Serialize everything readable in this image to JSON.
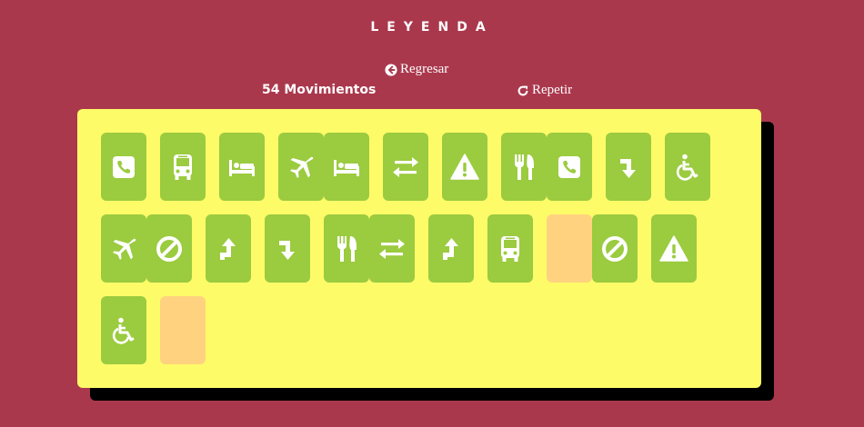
{
  "header": {
    "title": "LEYENDA"
  },
  "controls": {
    "back_label": "Regresar",
    "moves_label": "54 Movimientos",
    "repeat_label": "Repetir"
  },
  "colors": {
    "background": "#aa384d",
    "board": "#fefb68",
    "card_revealed": "#9bcb3f",
    "card_hidden": "#ffd27f"
  },
  "cards": [
    {
      "icon": "phone",
      "state": "revealed"
    },
    {
      "icon": "bus",
      "state": "revealed"
    },
    {
      "icon": "bed",
      "state": "revealed"
    },
    {
      "icon": "plane",
      "state": "revealed"
    },
    {
      "icon": "bed",
      "state": "revealed"
    },
    {
      "icon": "exchange",
      "state": "revealed"
    },
    {
      "icon": "warning",
      "state": "revealed"
    },
    {
      "icon": "cutlery",
      "state": "revealed"
    },
    {
      "icon": "phone",
      "state": "revealed"
    },
    {
      "icon": "turn-down",
      "state": "revealed"
    },
    {
      "icon": "wheelchair",
      "state": "revealed"
    },
    {
      "icon": "plane",
      "state": "revealed"
    },
    {
      "icon": "ban",
      "state": "revealed"
    },
    {
      "icon": "turn-up",
      "state": "revealed"
    },
    {
      "icon": "turn-down",
      "state": "revealed"
    },
    {
      "icon": "cutlery",
      "state": "revealed"
    },
    {
      "icon": "exchange",
      "state": "revealed"
    },
    {
      "icon": "turn-up",
      "state": "revealed"
    },
    {
      "icon": "bus",
      "state": "revealed"
    },
    {
      "icon": "",
      "state": "hidden"
    },
    {
      "icon": "ban",
      "state": "revealed"
    },
    {
      "icon": "warning",
      "state": "revealed"
    },
    {
      "icon": "wheelchair",
      "state": "revealed"
    },
    {
      "icon": "",
      "state": "hidden"
    }
  ]
}
